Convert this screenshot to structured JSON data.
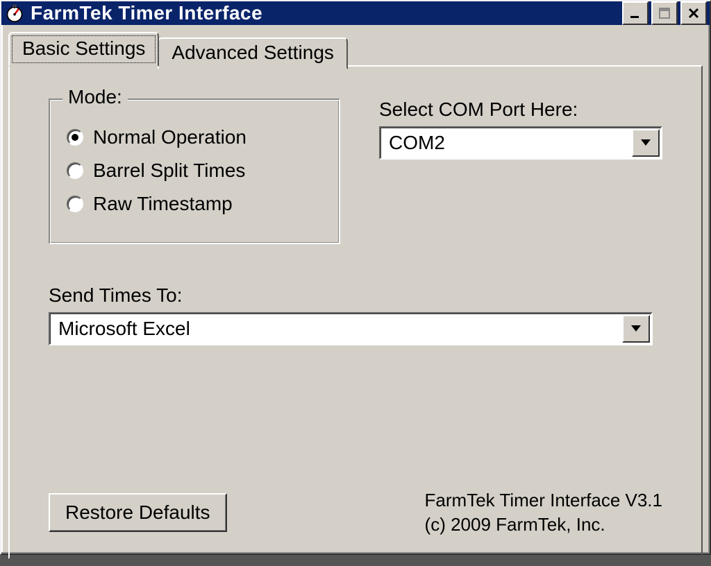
{
  "window": {
    "title": "FarmTek Timer Interface"
  },
  "tabs": [
    {
      "label": "Basic Settings",
      "active": true
    },
    {
      "label": "Advanced Settings",
      "active": false
    }
  ],
  "mode": {
    "legend": "Mode:",
    "options": [
      {
        "label": "Normal Operation",
        "selected": true
      },
      {
        "label": "Barrel Split Times",
        "selected": false
      },
      {
        "label": "Raw Timestamp",
        "selected": false
      }
    ]
  },
  "com": {
    "label": "Select COM Port Here:",
    "value": "COM2"
  },
  "sendto": {
    "label": "Send Times To:",
    "value": "Microsoft Excel"
  },
  "footer": {
    "restore_label": "Restore Defaults",
    "version_line1": "FarmTek Timer Interface V3.1",
    "version_line2": "(c) 2009 FarmTek, Inc."
  }
}
